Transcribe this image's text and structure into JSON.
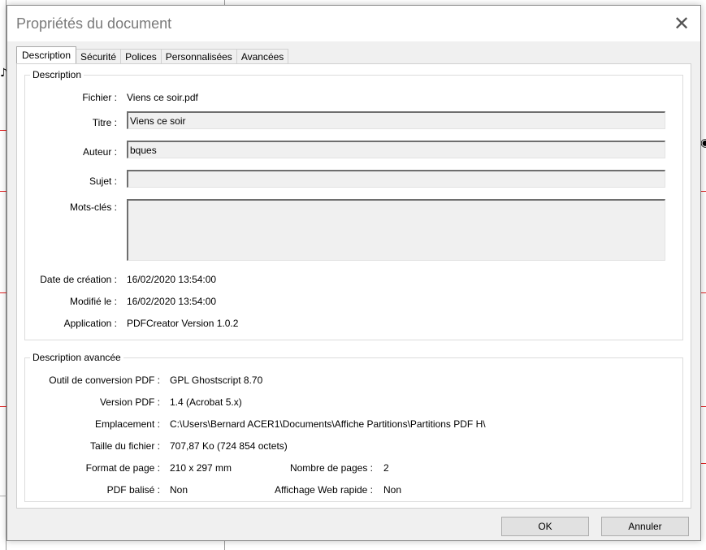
{
  "dialog": {
    "title": "Propriétés du document",
    "close_glyph": "✕"
  },
  "tabs": [
    {
      "label": "Description",
      "active": true
    },
    {
      "label": "Sécurité",
      "active": false
    },
    {
      "label": "Polices",
      "active": false
    },
    {
      "label": "Personnalisées",
      "active": false
    },
    {
      "label": "Avancées",
      "active": false
    }
  ],
  "description": {
    "group_title": "Description",
    "fichier_label": "Fichier :",
    "fichier_value": "Viens ce soir.pdf",
    "titre_label": "Titre :",
    "titre_value": "Viens ce soir",
    "auteur_label": "Auteur :",
    "auteur_value": "bques",
    "sujet_label": "Sujet :",
    "sujet_value": "",
    "motscles_label": "Mots-clés :",
    "motscles_value": "",
    "creation_label": "Date de création :",
    "creation_value": "16/02/2020 13:54:00",
    "modifie_label": "Modifié le :",
    "modifie_value": "16/02/2020 13:54:00",
    "application_label": "Application :",
    "application_value": "PDFCreator Version 1.0.2"
  },
  "advanced": {
    "group_title": "Description avancée",
    "outil_label": "Outil de conversion PDF :",
    "outil_value": "GPL Ghostscript 8.70",
    "version_label": "Version PDF :",
    "version_value": "1.4 (Acrobat 5.x)",
    "emplacement_label": "Emplacement :",
    "emplacement_value": "C:\\Users\\Bernard ACER1\\Documents\\Affiche Partitions\\Partitions PDF H\\",
    "taille_label": "Taille du fichier :",
    "taille_value": "707,87 Ko (724 854 octets)",
    "format_label": "Format de page :",
    "format_value": "210 x 297 mm",
    "pages_label": "Nombre de pages :",
    "pages_value": "2",
    "balise_label": "PDF balisé :",
    "balise_value": "Non",
    "web_label": "Affichage Web rapide :",
    "web_value": "Non"
  },
  "buttons": {
    "ok": "OK",
    "cancel": "Annuler"
  }
}
